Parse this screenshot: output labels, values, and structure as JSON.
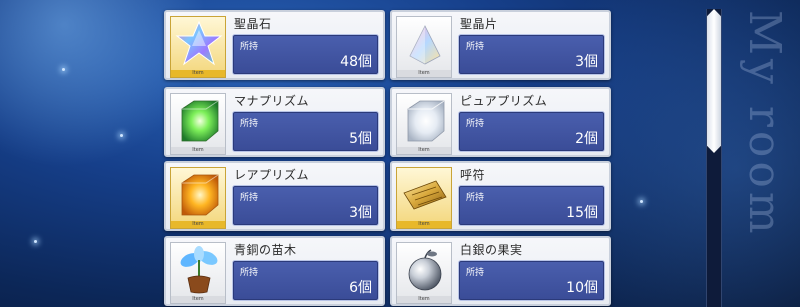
{
  "items": [
    {
      "name": "聖晶石",
      "qty_label": "所持",
      "qty": "48個",
      "icon": "saint-quartz-icon"
    },
    {
      "name": "聖晶片",
      "qty_label": "所持",
      "qty": "3個",
      "icon": "quartz-fragment-icon"
    },
    {
      "name": "マナプリズム",
      "qty_label": "所持",
      "qty": "5個",
      "icon": "mana-prism-icon"
    },
    {
      "name": "ピュアプリズム",
      "qty_label": "所持",
      "qty": "2個",
      "icon": "pure-prism-icon"
    },
    {
      "name": "レアプリズム",
      "qty_label": "所持",
      "qty": "3個",
      "icon": "rare-prism-icon"
    },
    {
      "name": "呼符",
      "qty_label": "所持",
      "qty": "15個",
      "icon": "summon-ticket-icon"
    },
    {
      "name": "青銅の苗木",
      "qty_label": "所持",
      "qty": "6個",
      "icon": "bronze-sapling-icon"
    },
    {
      "name": "白銀の果実",
      "qty_label": "所持",
      "qty": "10個",
      "icon": "silver-fruit-icon"
    }
  ],
  "icon_band_text": "Item",
  "watermark": "My room",
  "colors": {
    "card": "#eef1f6",
    "qty_box": "#4356a3",
    "background": "#163f8a"
  }
}
